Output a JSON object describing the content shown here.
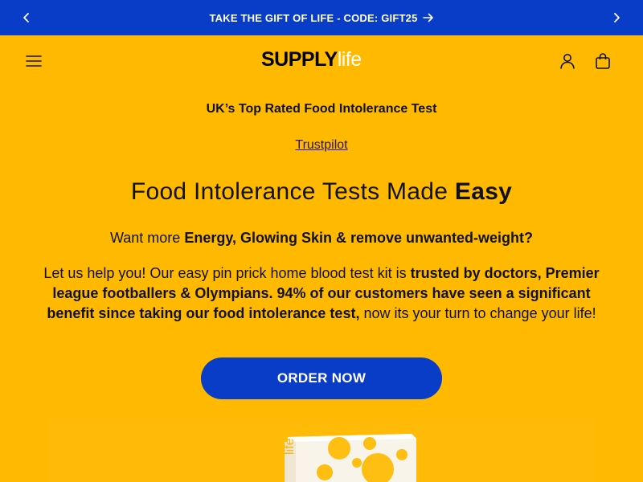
{
  "announcement": {
    "text": "TAKE THE GIFT OF LIFE - CODE: GIFT25"
  },
  "header": {
    "logo_bold": "SUPPLY",
    "logo_light": "life"
  },
  "hero": {
    "rated": "UK’s Top Rated Food Intolerance Test",
    "trustpilot": "Trustpilot",
    "headline_regular": "Food Intolerance Tests Made ",
    "headline_bold": "Easy",
    "subline_regular": "Want more ",
    "subline_bold": "Energy, Glowing Skin & remove unwanted-weight?",
    "para_1": "Let us help you! Our easy pin prick home blood test kit is ",
    "para_bold": "trusted by doctors, Premier league footballers & Olympians. 94% of our customers have seen a significant benefit since taking our food intolerance test,",
    "para_2": " now its your turn to change your life!",
    "cta": "ORDER NOW"
  },
  "product": {
    "box_brand": "life"
  },
  "colors": {
    "background": "#ffba00",
    "announcement_bar": "#0a3dc7",
    "button": "#0a3dc7"
  }
}
